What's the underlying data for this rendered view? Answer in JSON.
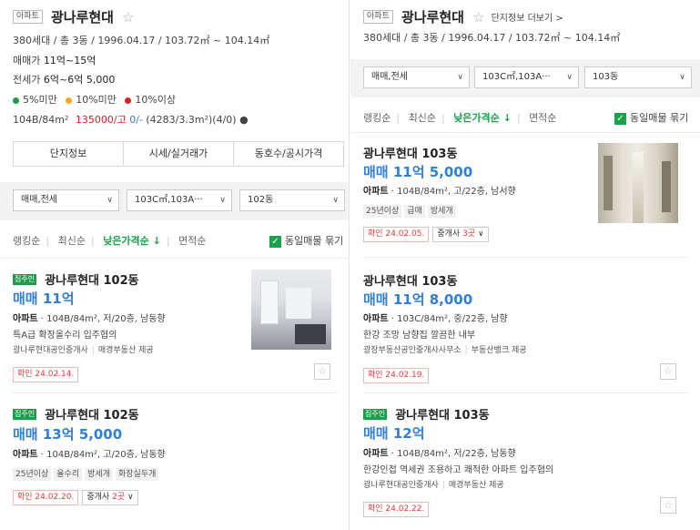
{
  "left": {
    "header": {
      "type_badge": "아파트",
      "name": "광나루현대",
      "star": "☆",
      "info": "380세대 / 총 3동 / 1996.04.17 / 103.72㎡ ~ 104.14㎡",
      "sale_label": "매매가",
      "sale_value": "11억~15억",
      "jeonse_label": "전세가",
      "jeonse_value": "6억~6억 5,000",
      "legend": [
        {
          "label": "5%미만",
          "color": "#1a9c3e"
        },
        {
          "label": "10%미만",
          "color": "#f5a623"
        },
        {
          "label": "10%이상",
          "color": "#e02020"
        }
      ],
      "area_line_prefix": "104B/84m²",
      "area_line_price": "135000/고",
      "area_line_zero": "0/-",
      "area_line_rest": "(4283/3.3m²)(4/0)",
      "area_dot": "●"
    },
    "tabs": [
      "단지정보",
      "시세/실거래가",
      "동호수/공시가격"
    ],
    "filters": {
      "trade": "매매,전세",
      "area": "103C㎡,103A···",
      "dong": "102동"
    },
    "sort": {
      "items": [
        "랭킹순",
        "최신순",
        "낮은가격순 ↓",
        "면적순"
      ],
      "active_index": 2,
      "same_listing": "동일매물 묶기"
    },
    "listings": [
      {
        "tag": "집주인",
        "name": "광나루현대 102동",
        "price": "매매 11억",
        "spec_type": "아파트",
        "spec_rest": " · 104B/84m², 저/20층, 남동향",
        "desc": "특A급 확장올수리 입주협의",
        "agent1": "광나루현대공인중개사",
        "agent2": "매경부동산 제공",
        "confirm": "확인 24.02.14.",
        "chips": [],
        "agent_count": ""
      },
      {
        "tag": "집주인",
        "name": "광나루현대 102동",
        "price": "매매 13억 5,000",
        "spec_type": "아파트",
        "spec_rest": " · 104B/84m², 고/20층, 남동향",
        "desc": "",
        "agent1": "",
        "agent2": "",
        "chips": [
          "25년이상",
          "올수리",
          "방세개",
          "화장실두개"
        ],
        "confirm": "확인 24.02.20.",
        "agent_count_prefix": "중개사",
        "agent_count_num": "2곳",
        "agent_count_chev": "∨"
      }
    ]
  },
  "right": {
    "header": {
      "type_badge": "아파트",
      "name": "광나루현대",
      "star": "☆",
      "more_link": "단지정보 더보기 >",
      "info": "380세대 / 총 3동 / 1996.04.17 / 103.72㎡ ~ 104.14㎡"
    },
    "filters": {
      "trade": "매매,전세",
      "area": "103C㎡,103A···",
      "dong": "103동"
    },
    "sort": {
      "items": [
        "랭킹순",
        "최신순",
        "낮은가격순 ↓",
        "면적순"
      ],
      "active_index": 2,
      "same_listing": "동일매물 묶기"
    },
    "listings": [
      {
        "tag": "",
        "name": "광나루현대 103동",
        "price": "매매 11억 5,000",
        "spec_type": "아파트",
        "spec_rest": " · 104B/84m², 고/22층, 남서향",
        "chips": [
          "25년이상",
          "급매",
          "방세개"
        ],
        "confirm": "확인 24.02.05.",
        "agent_count_prefix": "중개사",
        "agent_count_num": "3곳",
        "agent_count_chev": "∨"
      },
      {
        "tag": "",
        "name": "광나루현대 103동",
        "price": "매매 11억 8,000",
        "spec_type": "아파트",
        "spec_rest": " · 103C/84m², 중/22층, 남향",
        "desc": "한강 조망 남향집 깔끔한 내부",
        "agent1": "광장부동산공인중개사사무소",
        "agent2": "부동산뱅크 제공",
        "confirm": "확인 24.02.19."
      },
      {
        "tag": "집주인",
        "name": "광나루현대 103동",
        "price": "매매 12억",
        "spec_type": "아파트",
        "spec_rest": " · 104B/84m², 저/22층, 남동향",
        "desc": "한강인접 역세권 조용하고 쾌적한 아파트 입주협의",
        "agent1": "광나루현대공인중개사",
        "agent2": "매경부동산 제공",
        "confirm": "확인 24.02.22."
      }
    ]
  },
  "icons": {
    "star": "☆",
    "check": "✓",
    "chevron": "∨",
    "fav": "☆"
  }
}
